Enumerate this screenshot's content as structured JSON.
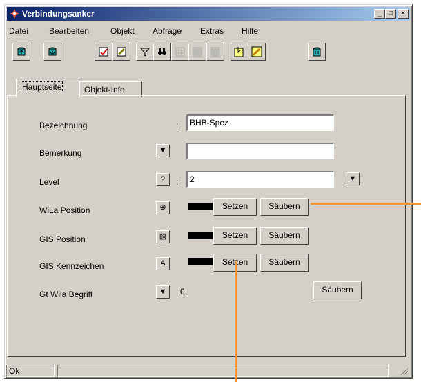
{
  "window": {
    "title": "Verbindungsanker",
    "controls": {
      "minimize": "_",
      "maximize": "□",
      "close": "×"
    }
  },
  "menu": [
    "Datei",
    "Bearbeiten",
    "Objekt",
    "Abfrage",
    "Extras",
    "Hilfe"
  ],
  "toolbar": [
    {
      "icon": "db-up-icon",
      "enabled": true
    },
    {
      "icon": "db-down-icon",
      "enabled": true
    },
    {
      "icon": "edit-check-icon",
      "enabled": true
    },
    {
      "icon": "edit-pen-icon",
      "enabled": true
    },
    {
      "icon": "filter-icon",
      "enabled": true
    },
    {
      "icon": "binoculars-icon",
      "enabled": true
    },
    {
      "icon": "table-icon",
      "enabled": false
    },
    {
      "icon": "blank-icon",
      "enabled": false
    },
    {
      "icon": "blank-icon",
      "enabled": false
    },
    {
      "icon": "attach-icon",
      "enabled": true
    },
    {
      "icon": "pencil-icon",
      "enabled": true
    },
    {
      "icon": "trash-icon",
      "enabled": true
    }
  ],
  "tabs": [
    {
      "label": "Hauptseite",
      "active": true
    },
    {
      "label": "Objekt-Info",
      "active": false
    }
  ],
  "form": {
    "bezeichnung": {
      "label": "Bezeichnung",
      "colon": ":",
      "value": "BHB-Spez"
    },
    "bemerkung": {
      "label": "Bemerkung",
      "button": "▼",
      "value": ""
    },
    "level": {
      "label": "Level",
      "button": "?",
      "colon": ":",
      "value": "2",
      "dropdown": "▼"
    },
    "wila_position": {
      "label": "WiLa Position",
      "button": "⊕",
      "set": "Setzen",
      "clear": "Säubern"
    },
    "gis_position": {
      "label": "GIS Position",
      "button": "▧",
      "set": "Setzen",
      "clear": "Säubern"
    },
    "gis_kennzeichen": {
      "label": "GIS Kennzeichen",
      "button": "A",
      "set": "Setzen",
      "clear": "Säubern"
    },
    "gt_wila_begriff": {
      "label": "Gt Wila Begriff",
      "button": "▼",
      "value": "0",
      "clear": "Säubern"
    }
  },
  "status": {
    "text": "Ok"
  },
  "colors": {
    "title_start": "#0a246a",
    "title_end": "#a6caf0",
    "face": "#d4d0c8",
    "annotation": "#f0943b"
  }
}
